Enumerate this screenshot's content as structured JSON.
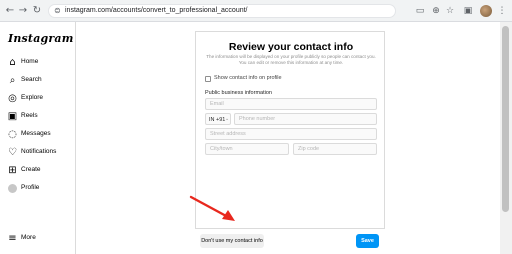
{
  "browser": {
    "url": "instagram.com/accounts/convert_to_professional_account/"
  },
  "sidebar": {
    "logo": "Instagram",
    "items": [
      {
        "label": "Home",
        "icon": "home-icon"
      },
      {
        "label": "Search",
        "icon": "search-icon"
      },
      {
        "label": "Explore",
        "icon": "explore-icon"
      },
      {
        "label": "Reels",
        "icon": "reels-icon"
      },
      {
        "label": "Messages",
        "icon": "messages-icon"
      },
      {
        "label": "Notifications",
        "icon": "heart-icon"
      },
      {
        "label": "Create",
        "icon": "plus-icon"
      },
      {
        "label": "Profile",
        "icon": "avatar"
      }
    ],
    "more_label": "More"
  },
  "form": {
    "title": "Review your contact info",
    "subtitle": "The information will be displayed on your profile publicly so people can contact you. You can edit or remove this information at any time.",
    "show_contact_label": "Show contact info on profile",
    "section_label": "Public business information",
    "email_placeholder": "Email",
    "country_code": "IN +91",
    "phone_placeholder": "Phone number",
    "street_placeholder": "Street address",
    "city_placeholder": "City/town",
    "zip_placeholder": "Zip code"
  },
  "actions": {
    "dont_use_label": "Don't use my contact info",
    "save_label": "Save"
  },
  "colors": {
    "primary_button": "#0095f6",
    "annotation_arrow": "#e8281e"
  }
}
